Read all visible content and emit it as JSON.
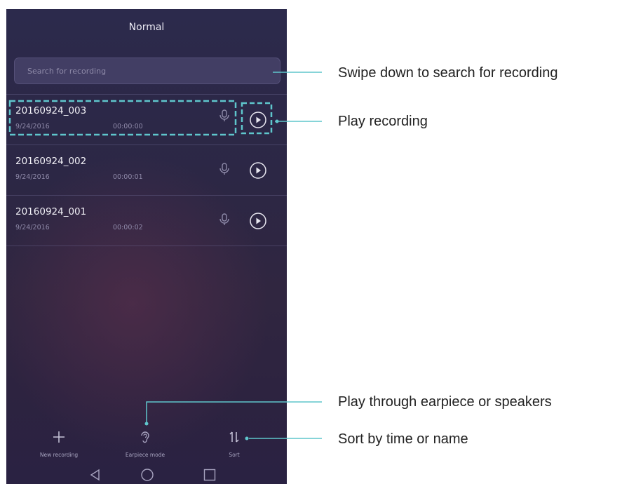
{
  "app": {
    "title": "Normal"
  },
  "search": {
    "placeholder": "Search for recording"
  },
  "recordings": [
    {
      "name": "20160924_003",
      "date": "9/24/2016",
      "duration": "00:00:00"
    },
    {
      "name": "20160924_002",
      "date": "9/24/2016",
      "duration": "00:00:01"
    },
    {
      "name": "20160924_001",
      "date": "9/24/2016",
      "duration": "00:00:02"
    }
  ],
  "toolbar": {
    "new_recording": "New recording",
    "earpiece_mode": "Earpiece mode",
    "sort": "Sort"
  },
  "annotations": {
    "swipe": "Swipe down to search for recording",
    "play": "Play recording",
    "earpiece": "Play through earpiece or speakers",
    "sort": "Sort by time or name"
  },
  "colors": {
    "callout": "#5fc6cc",
    "background": "#2c2745"
  }
}
